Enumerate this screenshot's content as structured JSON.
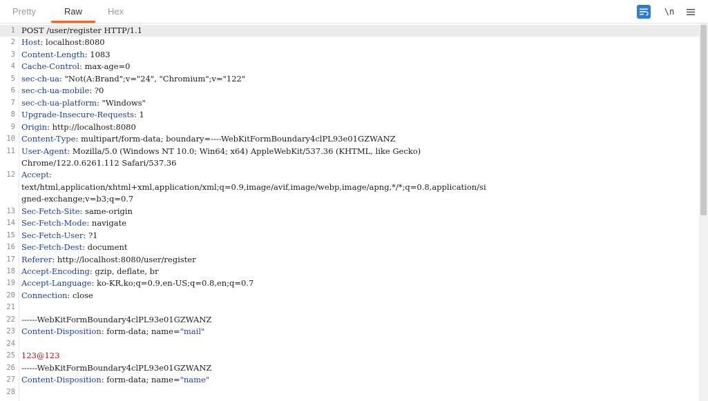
{
  "tabs": [
    {
      "label": "Pretty"
    },
    {
      "label": "Raw"
    },
    {
      "label": "Hex"
    }
  ],
  "active_tab": "Raw",
  "toolbar": {
    "newline_label": "\\n"
  },
  "colors": {
    "accent": "#f26522",
    "header_name": "#1b3f8b",
    "quoted_value": "#1f3fb5",
    "body_value": "#a31515",
    "wrap_button": "#2e7bcf"
  },
  "lines": [
    {
      "num": "1",
      "name": "",
      "sep": "",
      "value": "POST /user/register HTTP/1.1"
    },
    {
      "num": "2",
      "name": "Host",
      "sep": ": ",
      "value": "localhost:8080"
    },
    {
      "num": "3",
      "name": "Content-Length",
      "sep": ": ",
      "value": "1083"
    },
    {
      "num": "4",
      "name": "Cache-Control",
      "sep": ": ",
      "value": "max-age=0"
    },
    {
      "num": "5",
      "name": "sec-ch-ua",
      "sep": ": ",
      "value": "\"Not(A:Brand\";v=\"24\", \"Chromium\";v=\"122\""
    },
    {
      "num": "6",
      "name": "sec-ch-ua-mobile",
      "sep": ": ",
      "value": "?0"
    },
    {
      "num": "7",
      "name": "sec-ch-ua-platform",
      "sep": ": ",
      "value": "\"Windows\""
    },
    {
      "num": "8",
      "name": "Upgrade-Insecure-Requests",
      "sep": ": ",
      "value": "1"
    },
    {
      "num": "9",
      "name": "Origin",
      "sep": ": ",
      "value": "http://localhost:8080"
    },
    {
      "num": "10",
      "name": "Content-Type",
      "sep": ": ",
      "value": "multipart/form-data; boundary=----WebKitFormBoundary4clPL93e01GZWANZ"
    },
    {
      "num": "11",
      "name": "User-Agent",
      "sep": ": ",
      "value": "Mozilla/5.0 (Windows NT 10.0; Win64; x64) AppleWebKit/537.36 (KHTML, like Gecko)"
    },
    {
      "num": "",
      "name": "",
      "sep": "",
      "value": "Chrome/122.0.6261.112 Safari/537.36"
    },
    {
      "num": "12",
      "name": "Accept",
      "sep": ":",
      "value": ""
    },
    {
      "num": "",
      "name": "",
      "sep": "",
      "value": "text/html,application/xhtml+xml,application/xml;q=0.9,image/avif,image/webp,image/apng,*/*;q=0.8,application/si"
    },
    {
      "num": "",
      "name": "",
      "sep": "",
      "value": "gned-exchange;v=b3;q=0.7"
    },
    {
      "num": "13",
      "name": "Sec-Fetch-Site",
      "sep": ": ",
      "value": "same-origin"
    },
    {
      "num": "14",
      "name": "Sec-Fetch-Mode",
      "sep": ": ",
      "value": "navigate"
    },
    {
      "num": "15",
      "name": "Sec-Fetch-User",
      "sep": ": ",
      "value": "?1"
    },
    {
      "num": "16",
      "name": "Sec-Fetch-Dest",
      "sep": ": ",
      "value": "document"
    },
    {
      "num": "17",
      "name": "Referer",
      "sep": ": ",
      "value": "http://localhost:8080/user/register"
    },
    {
      "num": "18",
      "name": "Accept-Encoding",
      "sep": ": ",
      "value": "gzip, deflate, br"
    },
    {
      "num": "19",
      "name": "Accept-Language",
      "sep": ": ",
      "value": "ko-KR,ko;q=0.9,en-US;q=0.8,en;q=0.7"
    },
    {
      "num": "20",
      "name": "Connection",
      "sep": ": ",
      "value": "close"
    },
    {
      "num": "21",
      "name": "",
      "sep": "",
      "value": ""
    },
    {
      "num": "22",
      "name": "",
      "sep": "",
      "value": "------WebKitFormBoundary4clPL93e01GZWANZ"
    },
    {
      "num": "23",
      "name": "Content-Disposition",
      "sep": ": ",
      "value": "form-data; name=",
      "quoted": "\"mail\""
    },
    {
      "num": "24",
      "name": "",
      "sep": "",
      "value": ""
    },
    {
      "num": "25",
      "name": "",
      "sep": "",
      "value": "",
      "body": "123@123"
    },
    {
      "num": "26",
      "name": "",
      "sep": "",
      "value": "------WebKitFormBoundary4clPL93e01GZWANZ"
    },
    {
      "num": "27",
      "name": "Content-Disposition",
      "sep": ": ",
      "value": "form-data; name=",
      "quoted": "\"name\""
    },
    {
      "num": "28",
      "name": "",
      "sep": "",
      "value": ""
    }
  ]
}
